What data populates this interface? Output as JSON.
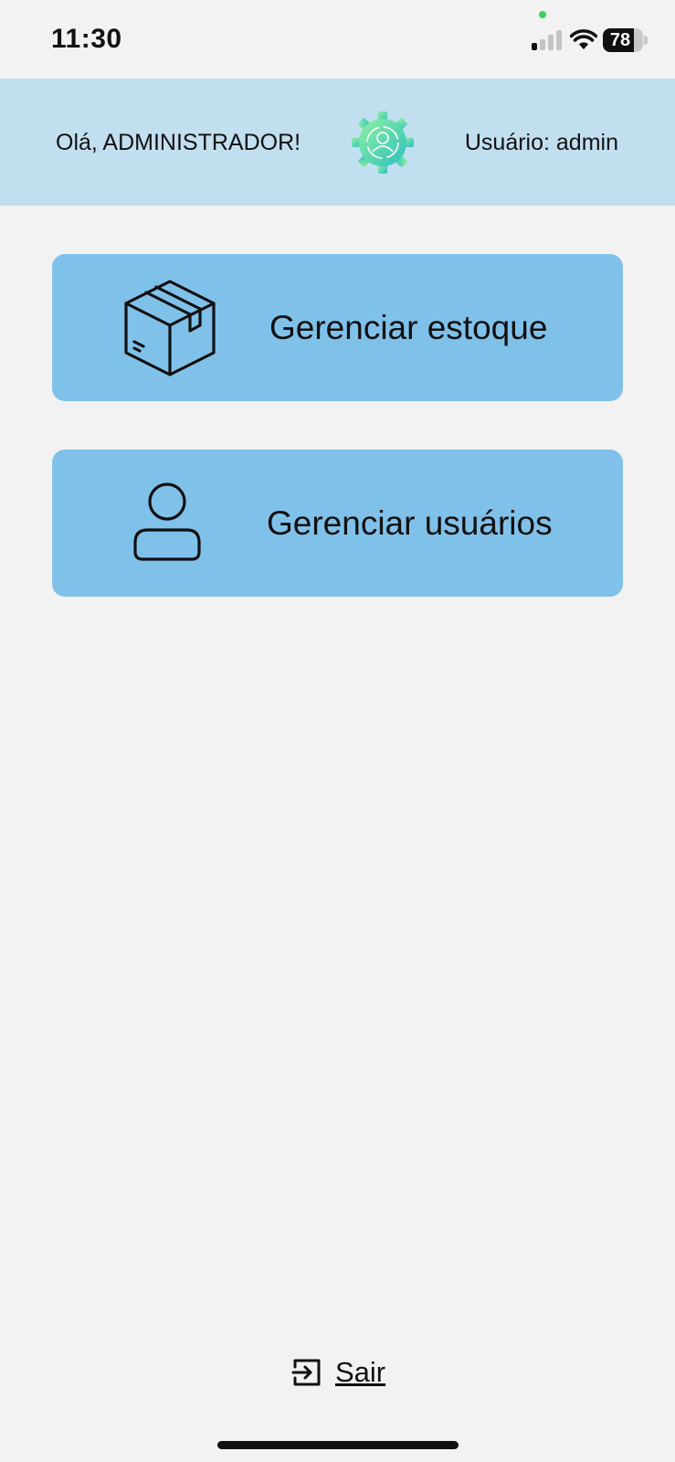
{
  "status_bar": {
    "time": "11:30",
    "battery_level": "78",
    "battery_percent": 78,
    "signal_bars_active": 1,
    "icons": [
      "signal-icon",
      "wifi-icon",
      "battery-icon"
    ]
  },
  "header": {
    "greeting": "Olá, ADMINISTRADOR!",
    "user_label": "Usuário: admin",
    "logo_icon": "gear-user-logo-icon",
    "background_color": "#c2dfef"
  },
  "menu": {
    "card_color": "#80c1ea",
    "items": [
      {
        "label": "Gerenciar estoque",
        "icon": "package-box-icon"
      },
      {
        "label": "Gerenciar usuários",
        "icon": "user-icon"
      }
    ]
  },
  "footer": {
    "logout_label": "Sair",
    "logout_icon": "logout-arrow-icon"
  },
  "colors": {
    "page_background": "#f2f2f2",
    "logo_gradient_start": "#7be8a8",
    "logo_gradient_end": "#3cc8c0"
  }
}
